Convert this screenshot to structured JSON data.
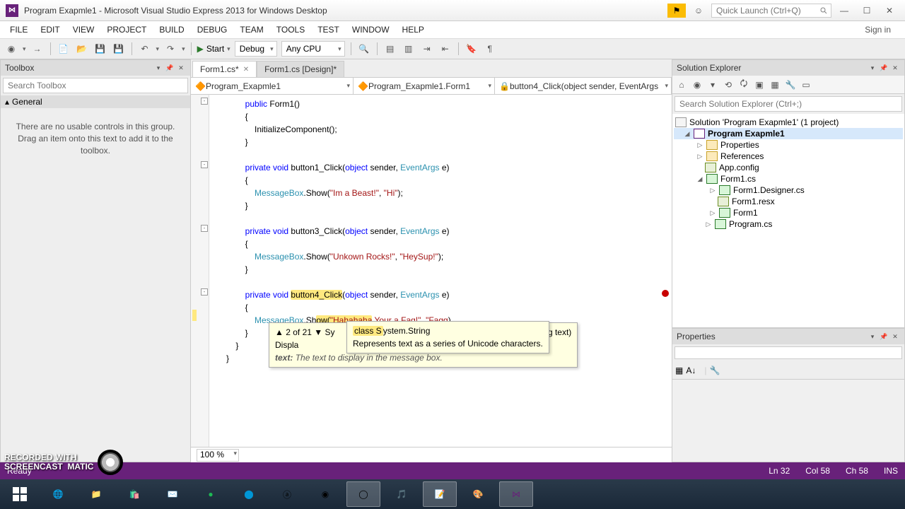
{
  "titlebar": {
    "title": "Program Exapmle1 - Microsoft Visual Studio Express 2013 for Windows Desktop",
    "quicklaunch_ph": "Quick Launch (Ctrl+Q)"
  },
  "menu": {
    "items": [
      "FILE",
      "EDIT",
      "VIEW",
      "PROJECT",
      "BUILD",
      "DEBUG",
      "TEAM",
      "TOOLS",
      "TEST",
      "WINDOW",
      "HELP"
    ],
    "signin": "Sign in"
  },
  "toolbar": {
    "start": "Start",
    "config": "Debug",
    "platform": "Any CPU"
  },
  "toolbox": {
    "title": "Toolbox",
    "search_ph": "Search Toolbox",
    "section": "General",
    "empty": "There are no usable controls in this group. Drag an item onto this text to add it to the toolbox."
  },
  "tabs": [
    {
      "label": "Form1.cs*",
      "active": true
    },
    {
      "label": "Form1.cs [Design]*",
      "active": false
    }
  ],
  "navbar": {
    "ns": "Program_Exapmle1",
    "cls": "Program_Exapmle1.Form1",
    "member": "button4_Click(object sender, EventArgs"
  },
  "code": {
    "lines": [
      "        public Form1()",
      "        {",
      "            InitializeComponent();",
      "        }",
      "",
      "        private void button1_Click(object sender, EventArgs e)",
      "        {",
      "            MessageBox.Show(\"Im a Beast!\", \"Hi\");",
      "        }",
      "",
      "        private void button3_Click(object sender, EventArgs e)",
      "        {",
      "            MessageBox.Show(\"Unkown Rocks!\", \"HeySup!\");",
      "        }",
      "",
      "        private void button4_Click(object sender, EventArgs e)",
      "        {",
      "            MessageBox.Show(\"Hahahaha Your a Fag!\", \"Fagg|)",
      "        }",
      "    }",
      "}"
    ]
  },
  "paramhelp": {
    "counter": "2 of 21",
    "sig_left": "Sy",
    "sig_right": "in32Window owner, string text)",
    "line2_left": "Displa",
    "line2_right": "with the specified text.",
    "line3": "text:  The text to display in the message box."
  },
  "quickinfo": {
    "l1": "class System.String",
    "l2": "Represents text as a series of Unicode characters."
  },
  "zoom": "100 %",
  "solexp": {
    "title": "Solution Explorer",
    "search_ph": "Search Solution Explorer (Ctrl+;)",
    "solution": "Solution 'Program Exapmle1' (1 project)",
    "project": "Program Exapmle1",
    "nodes": [
      "Properties",
      "References",
      "App.config",
      "Form1.cs",
      "Form1.Designer.cs",
      "Form1.resx",
      "Form1",
      "Program.cs"
    ]
  },
  "props": {
    "title": "Properties"
  },
  "status": {
    "left": "Ready",
    "ln": "Ln 32",
    "col": "Col 58",
    "ch": "Ch 58",
    "ins": "INS"
  },
  "watermark": {
    "l1": "RECORDED WITH",
    "l2": "SCREENCAST",
    "l3": "MATIC"
  }
}
